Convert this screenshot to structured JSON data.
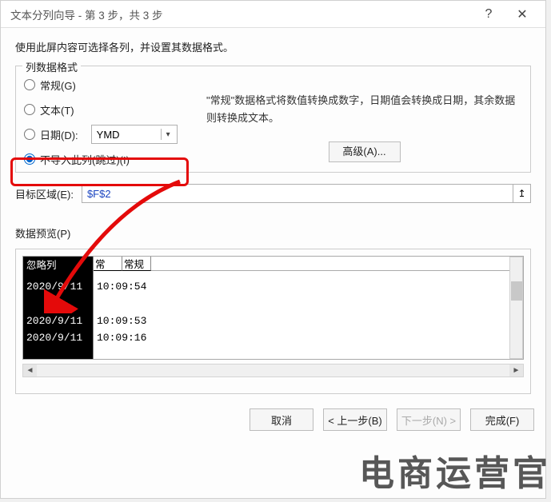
{
  "titlebar": {
    "title": "文本分列向导 - 第 3 步，共 3 步"
  },
  "instruction": "使用此屏内容可选择各列，并设置其数据格式。",
  "col_format": {
    "legend": "列数据格式",
    "general": "常规(G)",
    "text": "文本(T)",
    "date": "日期(D):",
    "date_value": "YMD",
    "skip": "不导入此列(跳过)(I)"
  },
  "desc": {
    "line1": "\"常规\"数据格式将数值转换成数字，日期值会转换成日期，其余数据则转换成文本。",
    "advanced": "高级(A)..."
  },
  "dest": {
    "label": "目标区域(E):",
    "value": "$F$2"
  },
  "preview": {
    "label": "数据预览(P)",
    "col1_head": "忽略列",
    "col2_head": "常",
    "col3_head": "常规",
    "rows_col1": [
      "2020/9/11",
      "",
      "2020/9/11",
      "2020/9/11"
    ],
    "rows_col2": [
      "10:09:54",
      "",
      "10:09:53",
      "10:09:16"
    ]
  },
  "buttons": {
    "cancel": "取消",
    "back": "< 上一步(B)",
    "next": "下一步(N) >",
    "finish": "完成(F)"
  },
  "watermark": "电商运营官"
}
